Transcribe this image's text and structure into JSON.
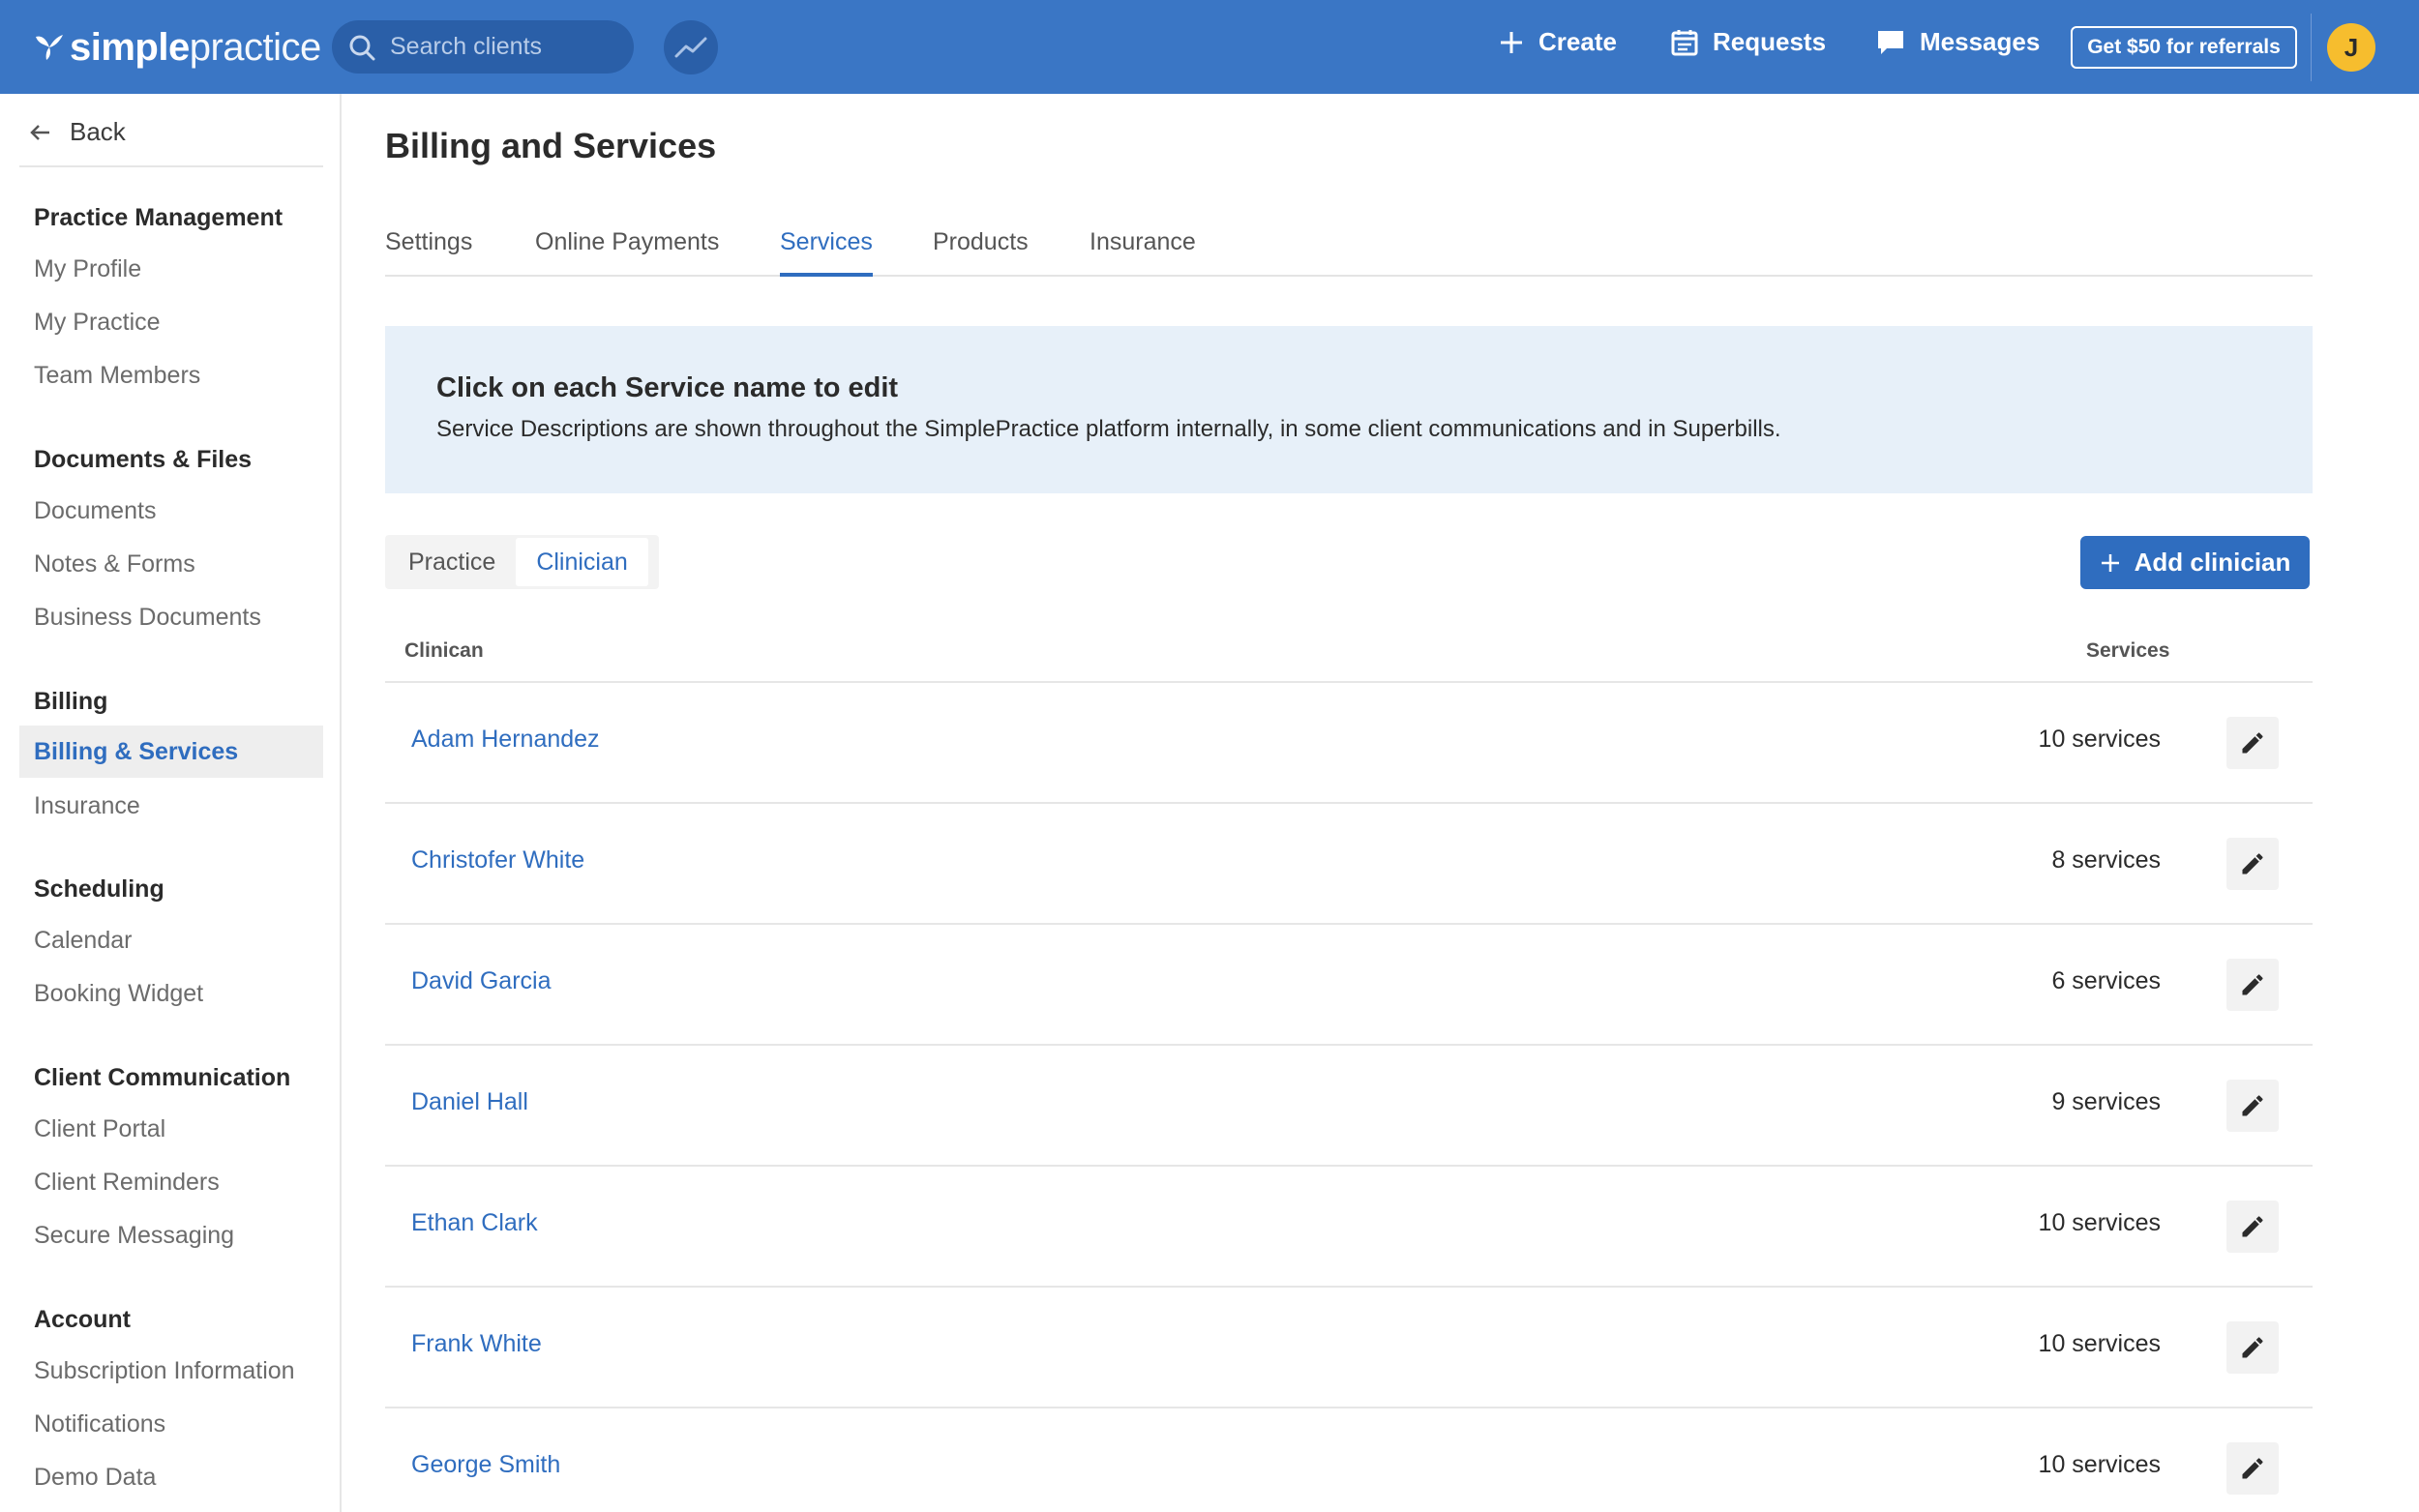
{
  "topbar": {
    "logo_bold": "simple",
    "logo_light": "practice",
    "search_placeholder": "Search clients",
    "create_label": "Create",
    "requests_label": "Requests",
    "messages_label": "Messages",
    "referral_label": "Get $50 for referrals",
    "avatar_initial": "J"
  },
  "sidebar": {
    "back_label": "Back",
    "sections": [
      {
        "title": "Practice Management",
        "items": [
          "My Profile",
          "My Practice",
          "Team Members"
        ]
      },
      {
        "title": "Documents & Files",
        "items": [
          "Documents",
          "Notes & Forms",
          "Business Documents"
        ]
      },
      {
        "title": "Billing",
        "items": [
          "Billing & Services",
          "Insurance"
        ]
      },
      {
        "title": "Scheduling",
        "items": [
          "Calendar",
          "Booking Widget"
        ]
      },
      {
        "title": "Client Communication",
        "items": [
          "Client Portal",
          "Client Reminders",
          "Secure Messaging"
        ]
      },
      {
        "title": "Account",
        "items": [
          "Subscription Information",
          "Notifications",
          "Demo Data"
        ]
      }
    ],
    "active_item": "Billing & Services"
  },
  "main": {
    "title": "Billing and Services",
    "tabs": [
      "Settings",
      "Online Payments",
      "Services",
      "Products",
      "Insurance"
    ],
    "active_tab": "Services",
    "banner": {
      "title": "Click on each Service name to edit",
      "text": "Service Descriptions are shown throughout the SimplePractice platform internally, in some client communications and in Superbills."
    },
    "segment": {
      "options": [
        "Practice",
        "Clinician"
      ],
      "active": "Clinician"
    },
    "add_button_label": "Add clinician",
    "table": {
      "headers": {
        "clinician": "Clinican",
        "services": "Services"
      },
      "rows": [
        {
          "name": "Adam Hernandez",
          "services": "10 services"
        },
        {
          "name": "Christofer White",
          "services": "8 services"
        },
        {
          "name": "David Garcia",
          "services": "6 services"
        },
        {
          "name": "Daniel Hall",
          "services": "9 services"
        },
        {
          "name": "Ethan Clark",
          "services": "10 services"
        },
        {
          "name": "Frank White",
          "services": "10 services"
        },
        {
          "name": "George Smith",
          "services": "10 services"
        }
      ]
    }
  },
  "colors": {
    "brand_blue": "#3a76c5",
    "link_blue": "#2f6dbf",
    "banner_bg": "#e7f0f9",
    "avatar_yellow": "#f6bd2e"
  }
}
